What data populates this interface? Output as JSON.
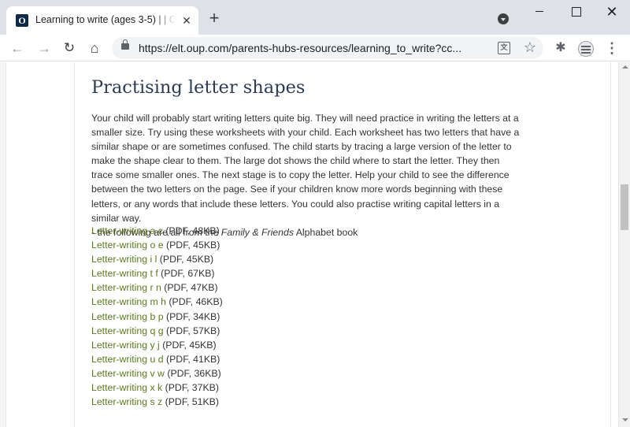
{
  "browser": {
    "tab": {
      "favicon_letter": "O",
      "title": "Learning to write (ages 3-5) | | O",
      "close_glyph": "✕"
    },
    "new_tab_glyph": "+",
    "window": {
      "close_glyph": "✕"
    },
    "toolbar": {
      "back_glyph": "←",
      "forward_glyph": "→",
      "reload_glyph": "↻",
      "home_glyph": "⌂",
      "url": "https://elt.oup.com/parents-hubs-resources/learning_to_write?cc...",
      "translate_glyph": "文",
      "star_glyph": "☆",
      "extensions_glyph": "✱",
      "menu_glyph": "⋮"
    },
    "icons": [
      "lock-icon",
      "translate-icon",
      "star-icon",
      "extensions-icon",
      "profile-icon",
      "menu-icon",
      "tab-search-icon"
    ]
  },
  "page": {
    "heading": "Practising letter shapes",
    "paragraph": "Your child will probably start writing letters quite big. They will need practice in writing the letters at a smaller size. Try using these worksheets with your child. Each worksheet has two letters that have a similar shape or are sometimes confused. The child starts by tracing a large version of the letter to make the shape clear to them. The large dot shows the child where to start the letter. They then trace some smaller ones. The next stage is to copy the letter. Help your child to see the difference between the two letters on the page. See if your children know more words beginning with these letters, or any words that include these letters. You could also practise writing capital letters in a similar way.",
    "source_note": {
      "prefix": "- the following are all from the ",
      "book": "Family & Friends",
      "suffix": " Alphabet book"
    },
    "worksheets": [
      {
        "label": "Letter-writing a c",
        "meta": " (PDF, 48KB)"
      },
      {
        "label": "Letter-writing o e",
        "meta": " (PDF, 45KB)"
      },
      {
        "label": "Letter-writing i l",
        "meta": " (PDF, 45KB)"
      },
      {
        "label": "Letter-writing t f",
        "meta": " (PDF, 67KB)"
      },
      {
        "label": "Letter-writing r n",
        "meta": " (PDF, 47KB)"
      },
      {
        "label": "Letter-writing m h",
        "meta": " (PDF, 46KB)"
      },
      {
        "label": "Letter-writing b p",
        "meta": " (PDF, 34KB)"
      },
      {
        "label": "Letter-writing q g",
        "meta": " (PDF, 57KB)"
      },
      {
        "label": "Letter-writing y j",
        "meta": " (PDF, 45KB)"
      },
      {
        "label": "Letter-writing u d",
        "meta": " (PDF, 41KB)"
      },
      {
        "label": "Letter-writing v w",
        "meta": " (PDF, 36KB)"
      },
      {
        "label": "Letter-writing x k",
        "meta": " (PDF, 37KB)"
      },
      {
        "label": "Letter-writing s z",
        "meta": " (PDF, 51KB)"
      }
    ]
  },
  "colors": {
    "link": "#5a7a1e",
    "heading": "#2b3a55",
    "body_text": "#333333",
    "tabstrip": "#dee1e6"
  }
}
